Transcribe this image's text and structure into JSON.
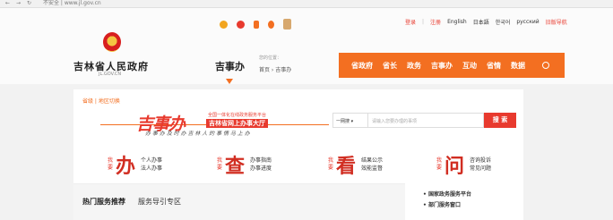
{
  "browser": {
    "url_label": "不安全 | www.jl.gov.cn"
  },
  "header": {
    "icons": [
      "weibo-icon",
      "wechat-icon",
      "mobile-icon",
      "accessibility-icon",
      "mascot-icon"
    ],
    "links": [
      "登录",
      "注册",
      "English",
      "日本語",
      "한국어",
      "русский",
      "旧版导航"
    ],
    "gov_title": "吉林省人民政府",
    "gov_domain": "JL.GOV.CN",
    "section_title": "吉事办",
    "site_nav": "您的位置：",
    "breadcrumb": "首页 › 吉事办"
  },
  "nav": {
    "items": [
      "省政府",
      "省长",
      "政务",
      "吉事办",
      "互动",
      "省情",
      "数据"
    ]
  },
  "main": {
    "region_switch": "省级 | 地区切换",
    "banner": {
      "big": "吉事办",
      "slogan_top": "全国一体化在线政务服务平台",
      "slogan_box": "吉林省网上办事大厅",
      "slogan_bottom": "办 事 办   及 时 办   吉 林 人 的 事 情 马 上 办"
    },
    "search": {
      "scope": "一网搜 ▾",
      "placeholder": "请输入您要办理的事项",
      "button": "搜 索"
    },
    "services": [
      {
        "prefix": "我要",
        "glyph": "办",
        "items": [
          "个人办事",
          "法人办事"
        ]
      },
      {
        "prefix": "我要",
        "glyph": "查",
        "items": [
          "办事指南",
          "办事进度"
        ]
      },
      {
        "prefix": "我要",
        "glyph": "看",
        "items": [
          "结果公示",
          "效能监督"
        ]
      },
      {
        "prefix": "我要",
        "glyph": "问",
        "items": [
          "咨询投诉",
          "常见问题"
        ]
      }
    ],
    "hot_title": "热门服务推荐",
    "guide_title": "服务导引专区",
    "side_links": [
      "国家政务服务平台",
      "部门服务窗口"
    ]
  },
  "colors": {
    "accent": "#f36f21",
    "red": "#e83a2e"
  }
}
